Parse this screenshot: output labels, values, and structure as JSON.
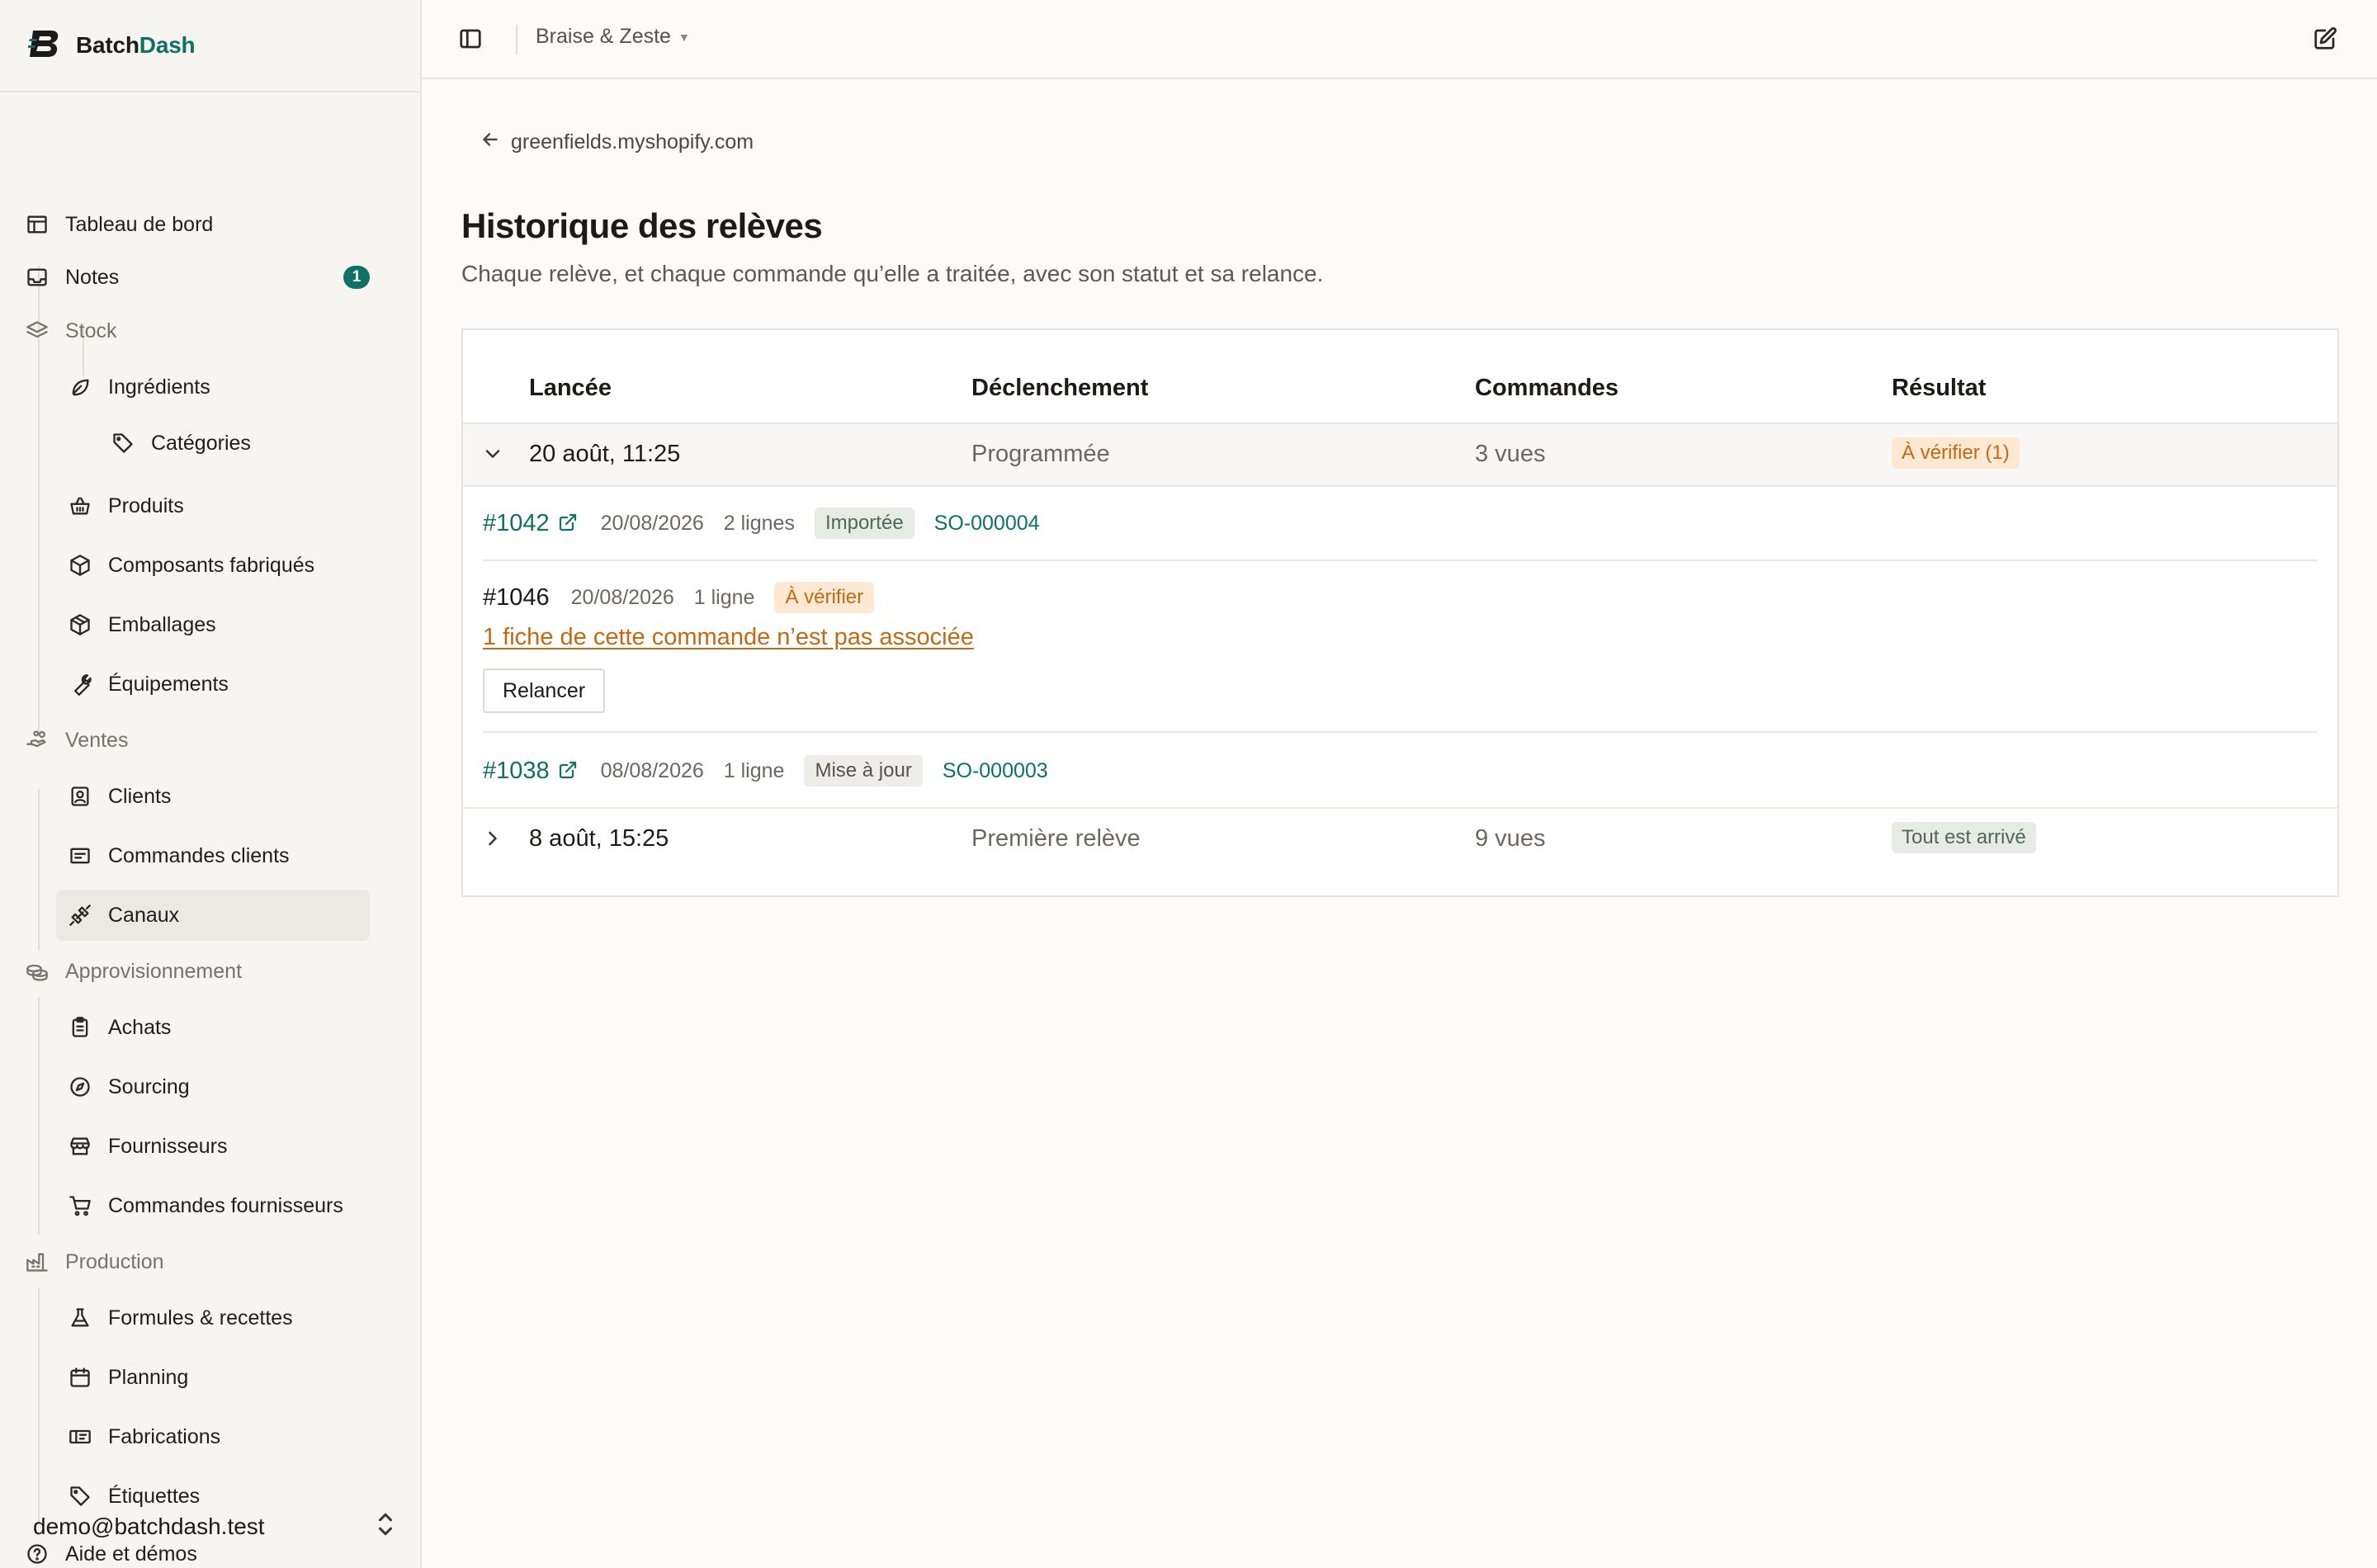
{
  "brand": {
    "name_a": "Batch",
    "name_b": "Dash"
  },
  "sidebar": {
    "items": [
      {
        "label": "Tableau de bord",
        "icon": "layout-icon"
      },
      {
        "label": "Notes",
        "icon": "inbox-icon",
        "badge": "1"
      },
      {
        "label": "Stock",
        "icon": "layers-icon"
      },
      {
        "label": "Ingrédients",
        "icon": "leaf-icon"
      },
      {
        "label": "Catégories",
        "icon": "tag-icon"
      },
      {
        "label": "Produits",
        "icon": "basket-icon"
      },
      {
        "label": "Composants fabriqués",
        "icon": "box-icon"
      },
      {
        "label": "Emballages",
        "icon": "package-icon"
      },
      {
        "label": "Équipements",
        "icon": "wrench-icon"
      },
      {
        "label": "Ventes",
        "icon": "hand-coins-icon"
      },
      {
        "label": "Clients",
        "icon": "contact-icon"
      },
      {
        "label": "Commandes clients",
        "icon": "receipt-icon"
      },
      {
        "label": "Canaux",
        "icon": "plug-icon"
      },
      {
        "label": "Approvisionnement",
        "icon": "coins-icon"
      },
      {
        "label": "Achats",
        "icon": "clipboard-icon"
      },
      {
        "label": "Sourcing",
        "icon": "compass-icon"
      },
      {
        "label": "Fournisseurs",
        "icon": "store-icon"
      },
      {
        "label": "Commandes fournisseurs",
        "icon": "cart-icon"
      },
      {
        "label": "Production",
        "icon": "factory-icon"
      },
      {
        "label": "Formules & recettes",
        "icon": "flask-icon"
      },
      {
        "label": "Planning",
        "icon": "calendar-icon"
      },
      {
        "label": "Fabrications",
        "icon": "ticket-icon"
      },
      {
        "label": "Étiquettes",
        "icon": "tag-icon"
      },
      {
        "label": "Aide et démos",
        "icon": "help-circle-icon"
      }
    ],
    "user_email": "demo@batchdash.test"
  },
  "topbar": {
    "workspace": "Braise & Zeste"
  },
  "back_link": "greenfields.myshopify.com",
  "page": {
    "title": "Historique des relèves",
    "subtitle": "Chaque relève, et chaque commande qu’elle a traitée, avec son statut et sa relance."
  },
  "table": {
    "headers": [
      "Lancée",
      "Déclenchement",
      "Commandes",
      "Résultat"
    ],
    "runs": [
      {
        "launched": "20 août, 11:25",
        "trigger": "Programmée",
        "orders": "3 vues",
        "result": "À vérifier (1)",
        "orders_detail": [
          {
            "number": "#1042",
            "date": "20/08/2026",
            "lines": "2 lignes",
            "status": "Importée",
            "so": "SO-000004"
          },
          {
            "number": "#1046",
            "date": "20/08/2026",
            "lines": "1 ligne",
            "status": "À vérifier",
            "warning": "1 fiche de cette commande n’est pas associée",
            "action": "Relancer"
          },
          {
            "number": "#1038",
            "date": "08/08/2026",
            "lines": "1 ligne",
            "status": "Mise à jour",
            "so": "SO-000003"
          }
        ]
      },
      {
        "launched": "8 août, 15:25",
        "trigger": "Première relève",
        "orders": "9 vues",
        "result": "Tout est arrivé"
      }
    ]
  },
  "colors": {
    "accent": "#0d7166",
    "warning": "#c26a12",
    "warning_bg": "#fde9d3",
    "success_bg": "#e6ece3"
  }
}
